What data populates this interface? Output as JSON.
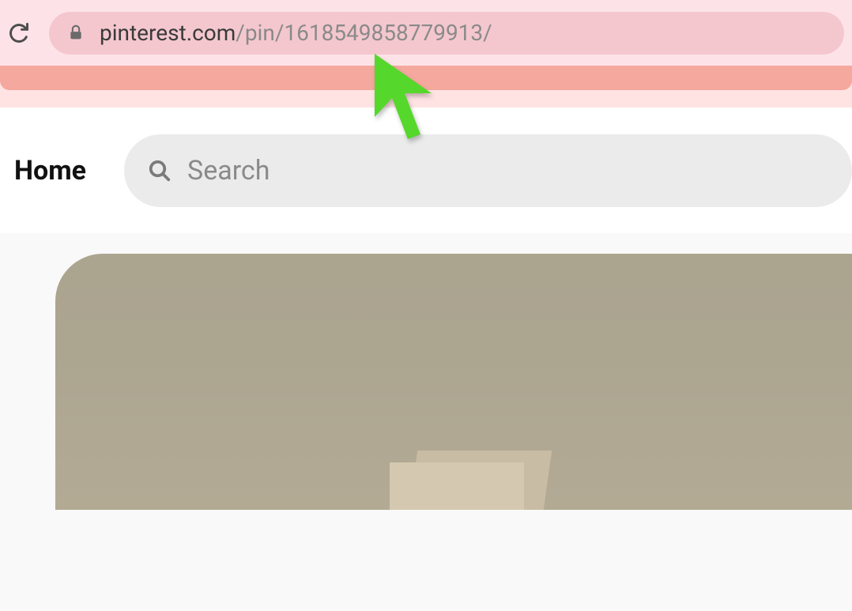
{
  "browser": {
    "url_domain": "pinterest.com",
    "url_path": "/pin/1618549858779913/"
  },
  "header": {
    "home_label": "Home",
    "search_placeholder": "Search"
  },
  "colors": {
    "accent_pink": "#f5a89e",
    "chrome_pink": "#fde3e8",
    "cursor_green": "#56d72b"
  }
}
